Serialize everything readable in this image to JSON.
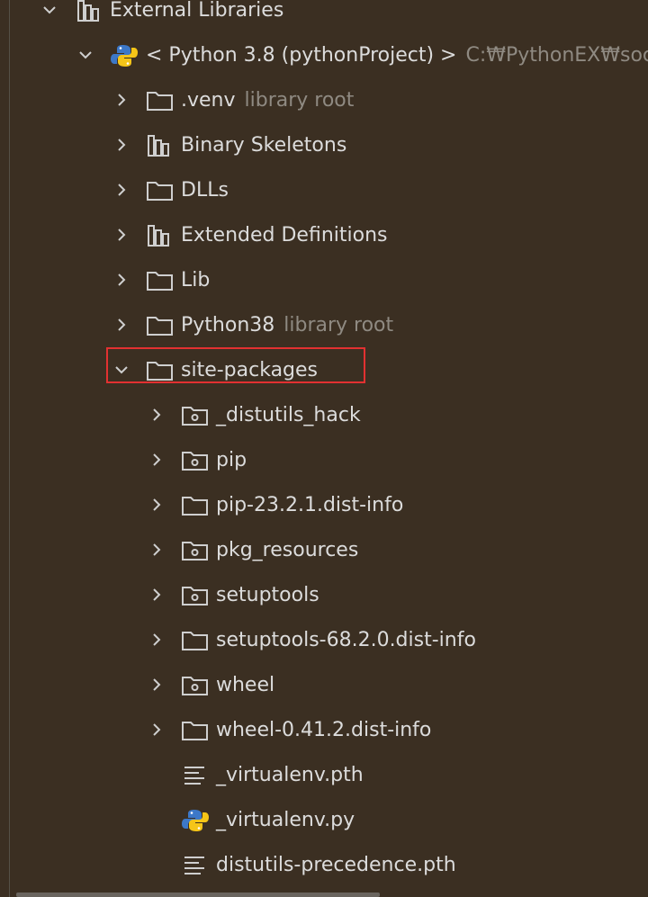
{
  "tree": {
    "external_libraries": {
      "label": "External Libraries",
      "icon": "library-icon",
      "expanded": true
    },
    "python_sdk": {
      "label": "< Python 3.8 (pythonProject) >",
      "path": "C:₩PythonEX₩soc",
      "icon": "python-icon",
      "expanded": true
    },
    "sdk_children": [
      {
        "label": ".venv",
        "hint": "library root",
        "icon": "folder-icon",
        "expanded": false
      },
      {
        "label": "Binary Skeletons",
        "hint": "",
        "icon": "library-icon",
        "expanded": false
      },
      {
        "label": "DLLs",
        "hint": "",
        "icon": "folder-icon",
        "expanded": false
      },
      {
        "label": "Extended Definitions",
        "hint": "",
        "icon": "library-icon",
        "expanded": false
      },
      {
        "label": "Lib",
        "hint": "",
        "icon": "folder-icon",
        "expanded": false
      },
      {
        "label": "Python38",
        "hint": "library root",
        "icon": "folder-icon",
        "expanded": false
      },
      {
        "label": "site-packages",
        "hint": "",
        "icon": "folder-icon",
        "expanded": true
      }
    ],
    "site_packages_children": [
      {
        "label": "_distutils_hack",
        "icon": "package-folder-icon",
        "expandable": true
      },
      {
        "label": "pip",
        "icon": "package-folder-icon",
        "expandable": true
      },
      {
        "label": "pip-23.2.1.dist-info",
        "icon": "folder-icon",
        "expandable": true
      },
      {
        "label": "pkg_resources",
        "icon": "package-folder-icon",
        "expandable": true
      },
      {
        "label": "setuptools",
        "icon": "package-folder-icon",
        "expandable": true
      },
      {
        "label": "setuptools-68.2.0.dist-info",
        "icon": "folder-icon",
        "expandable": true
      },
      {
        "label": "wheel",
        "icon": "package-folder-icon",
        "expandable": true
      },
      {
        "label": "wheel-0.41.2.dist-info",
        "icon": "folder-icon",
        "expandable": true
      },
      {
        "label": "_virtualenv.pth",
        "icon": "text-file-icon",
        "expandable": false
      },
      {
        "label": "_virtualenv.py",
        "icon": "python-file-icon",
        "expandable": false
      },
      {
        "label": "distutils-precedence.pth",
        "icon": "text-file-icon",
        "expandable": false
      }
    ]
  },
  "colors": {
    "background": "#3b2f22",
    "text": "#dcdcdc",
    "hint_text": "#8f8a82",
    "highlight_border": "#e23131",
    "python_blue": "#3c78c8",
    "python_yellow": "#f5c518"
  }
}
